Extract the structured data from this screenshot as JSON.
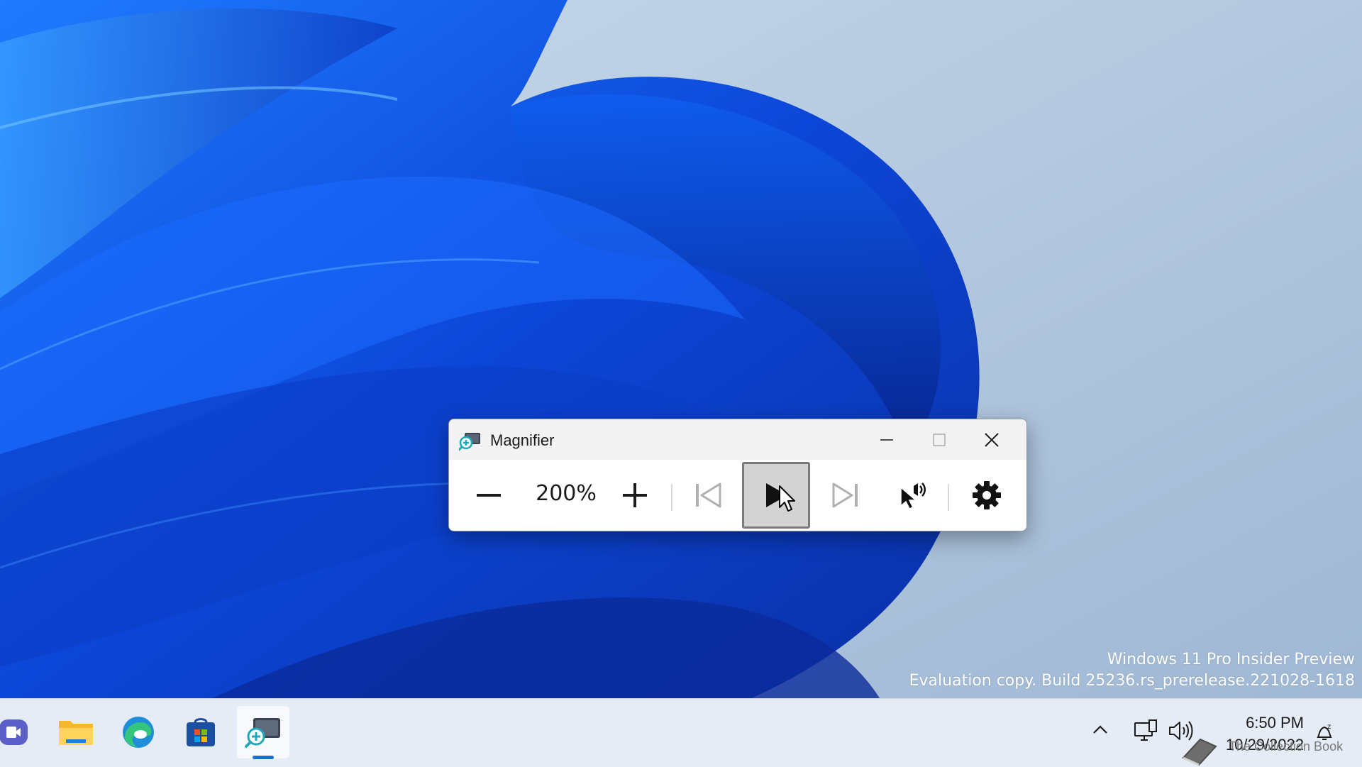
{
  "desktop": {
    "watermark_line1": "Windows 11 Pro Insider Preview",
    "watermark_line2": "Evaluation copy. Build 25236.rs_prerelease.221028-1618"
  },
  "magnifier": {
    "title": "Magnifier",
    "zoom_level": "200%",
    "buttons": {
      "zoom_out": "minus-icon",
      "zoom_in": "plus-icon",
      "previous": "skip-previous-icon",
      "play": "play-icon",
      "next": "skip-next-icon",
      "read_from_cursor": "read-aloud-pointer-icon",
      "settings": "gear-icon"
    }
  },
  "taskbar": {
    "apps": [
      "meet-icon",
      "file-explorer-icon",
      "edge-icon",
      "store-icon",
      "magnifier-icon"
    ],
    "active_app": "magnifier-icon",
    "tray": [
      "chevron-up-icon",
      "network-icon",
      "volume-icon"
    ],
    "time": "6:50 PM",
    "date": "10/29/2022",
    "overlay_text": "The Collection Book"
  },
  "colors": {
    "wallpaper_background": "#b4c8dc",
    "taskbar_background": "#e6ecf5",
    "accent": "#1a6fd8"
  }
}
